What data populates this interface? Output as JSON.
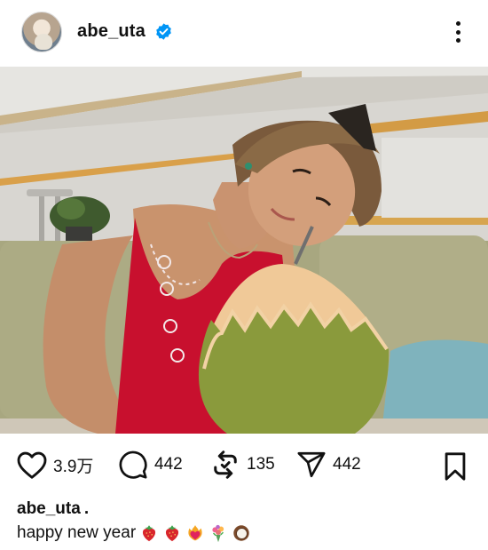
{
  "post": {
    "username": "abe_uta",
    "verified": true,
    "avatar_icon": "profile-avatar",
    "more_icon": "more-vertical-icon",
    "photo_alt_icon": "photo-woman-with-coconut"
  },
  "actions": {
    "like": {
      "icon": "heart-icon",
      "count": "3.9万"
    },
    "comment": {
      "icon": "comment-icon",
      "count": "442"
    },
    "repost": {
      "icon": "repost-icon",
      "count": "135"
    },
    "share": {
      "icon": "send-icon",
      "count": "442"
    },
    "save": {
      "icon": "bookmark-icon"
    }
  },
  "caption": {
    "username": "abe_uta",
    "separator": ".",
    "text": "happy new year",
    "emojis": [
      "strawberry",
      "strawberry",
      "heart-on-fire",
      "bouquet",
      "coconut"
    ]
  },
  "colors": {
    "verified_blue": "#0095f6",
    "text": "#111111",
    "dress_red": "#c8102e",
    "sofa_green": "#a7a77a"
  }
}
